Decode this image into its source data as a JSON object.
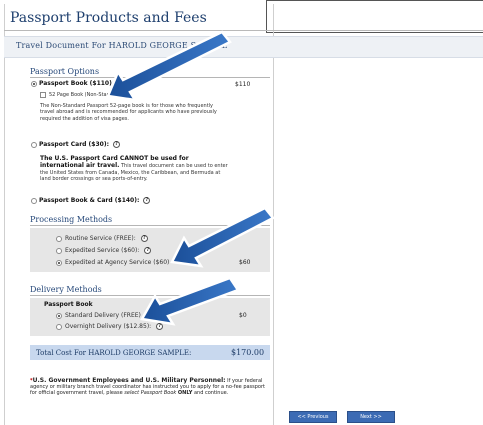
{
  "page": {
    "title": "Passport Products and Fees",
    "banner": "Travel Document For HAROLD GEORGE SAMPLE"
  },
  "passport_options": {
    "heading": "Passport Options",
    "book": {
      "label": "Passport Book ($110):",
      "price": "$110",
      "selected": true
    },
    "book_52": {
      "label": "52 Page Book (Non-Standard)"
    },
    "book_52_desc": "The Non-Standard Passport 52-page book is for those who frequently travel abroad and is recommended for applicants who have previously required the addition of visa pages.",
    "card": {
      "label": "Passport Card ($30):",
      "selected": false
    },
    "card_warning_bold": "The U.S. Passport Card CANNOT be used for international air travel.",
    "card_warning_rest": "This travel document can be used to enter the United States from Canada, Mexico, the Caribbean, and Bermuda at land border crossings or sea ports-of-entry.",
    "book_card": {
      "label": "Passport Book & Card ($140):",
      "selected": false
    }
  },
  "processing_methods": {
    "heading": "Processing Methods",
    "routine": "Routine Service (FREE):",
    "expedited": "Expedited Service ($60):",
    "agency": "Expedited at Agency Service ($60)",
    "agency_price": "$60",
    "selected": "agency"
  },
  "delivery_methods": {
    "heading": "Delivery Methods",
    "subheading": "Passport Book",
    "standard": "Standard Delivery (FREE)",
    "overnight": "Overnight Delivery ($12.85):",
    "standard_price": "$0",
    "selected": "standard"
  },
  "total": {
    "label": "Total Cost For HAROLD GEORGE SAMPLE:",
    "value": "$170.00"
  },
  "footer": {
    "star": "*",
    "bold": "U.S. Government Employees and U.S. Military Personnel:",
    "text1": "If your federal agency or military branch travel coordinator has instructed you to apply for a no-fee passport for official government travel, please",
    "italic": "select Passport Book",
    "only": "ONLY",
    "text2": "and continue."
  },
  "buttons": {
    "previous": "<< Previous",
    "next": "Next >>"
  },
  "colors": {
    "title": "#1e3f6e",
    "arrow": "#1f5aa8",
    "total_bar": "#c8d8ee",
    "button": "#3c6bb4"
  }
}
